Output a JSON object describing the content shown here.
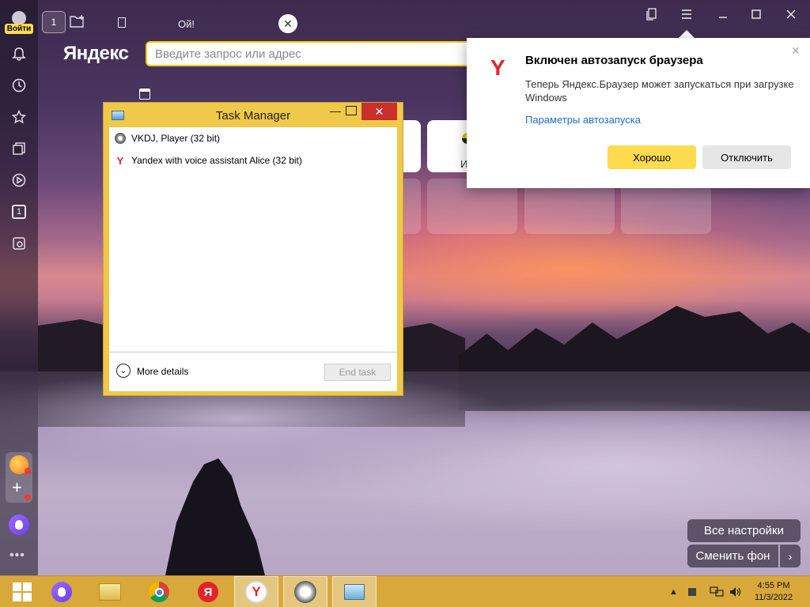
{
  "sidebar": {
    "login_label": "Войти",
    "tab_counter": "1"
  },
  "tabs": {
    "home_counter": "1",
    "active_tab_title": "Ой!"
  },
  "browser": {
    "logo": "Яндекс",
    "address_placeholder": "Введите запрос или адрес"
  },
  "tiles": {
    "partial_label": "И"
  },
  "popup": {
    "logo": "Y",
    "title": "Включен автозапуск браузера",
    "text": "Теперь Яндекс.Браузер может запускаться при загрузке Windows",
    "link": "Параметры автозапуска",
    "ok_label": "Хорошо",
    "off_label": "Отключить"
  },
  "task_manager": {
    "title": "Task Manager",
    "processes": [
      {
        "name": "VKDJ, Player (32 bit)"
      },
      {
        "name": "Yandex with voice assistant Alice (32 bit)"
      }
    ],
    "more_details": "More details",
    "end_task": "End task"
  },
  "newtab": {
    "all_settings": "Все настройки",
    "change_bg": "Сменить фон"
  },
  "taskbar": {
    "ya_label": "Я",
    "browser_label": "Y",
    "time": "4:55 PM",
    "date": "11/3/2022"
  },
  "colors": {
    "accent_yellow": "#ffdb4d",
    "yandex_red": "#e3232c",
    "taskbar": "#d8a83a",
    "link": "#1a6ec2"
  }
}
